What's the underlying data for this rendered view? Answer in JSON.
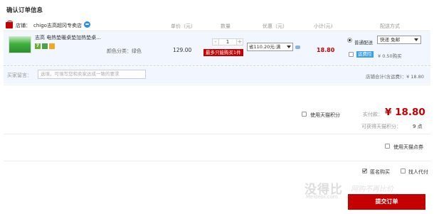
{
  "page_title": "确认订单信息",
  "header": {
    "shop_label": "店铺：",
    "shop_name": "chigo志高超冈专卖店",
    "columns": [
      "单价（元）",
      "数量",
      "优惠（元）",
      "小计(元)",
      "配送方式"
    ]
  },
  "item": {
    "name": "志高 电热垫暖桌垫加热垫桌...",
    "badge_text": "7",
    "attribute": "颜色分类：绿色",
    "unit_price": "129.00",
    "quantity": "1",
    "qty_minus": "-",
    "qty_plus": "+",
    "limit_notice": "最多只能购买1件",
    "promo_select": "省110.20元:满",
    "subtotal": "18.80"
  },
  "shipping": {
    "option_label": "普通配送",
    "selected_method": "快递 免邮",
    "eticket_label": "运费险",
    "eticket_price": "¥ 0.50购买"
  },
  "message": {
    "label": "买家留言：",
    "placeholder": "选填，可填写您和卖家达成一致的要求",
    "shop_total": "店铺合计(含运费)：¥ 18.80"
  },
  "summary": {
    "use_points": "使用天猫积分",
    "paid_label": "实付款：",
    "paid_amount": "¥ 18.80",
    "points_label": "可获得天猫积分：",
    "points_value": "9 点",
    "use_coupon": "使用天猫点券",
    "anonymous": "匿名购买",
    "proxy_pay": "找人代付",
    "submit": "提交订单"
  },
  "watermark": {
    "text": "没得比",
    "sub": "Meidebi.com",
    "slogan": "网购不再比价"
  },
  "colors": {
    "accent": "#c40000",
    "row_bg": "#f2f7ff",
    "link_blue": "#3aa0e8"
  }
}
